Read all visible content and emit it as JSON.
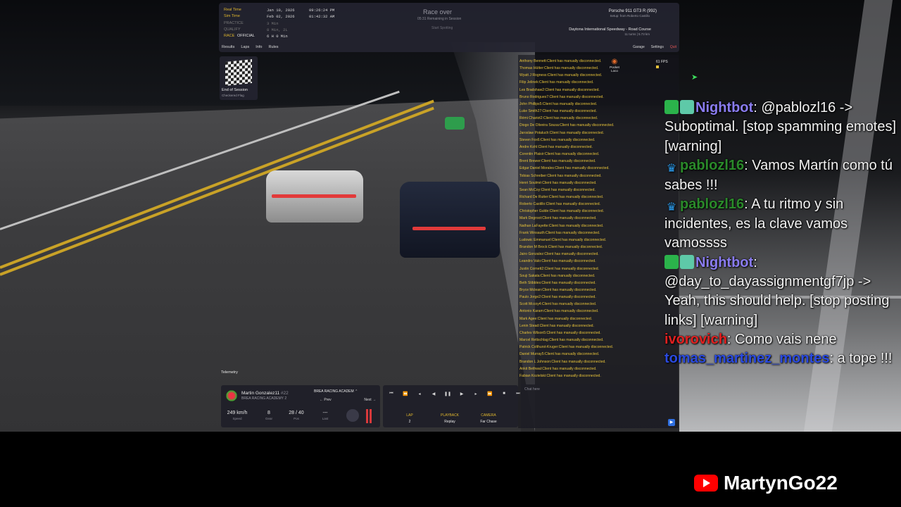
{
  "sim": {
    "time_rows": [
      {
        "label": "Real Time",
        "date": "Jan 10, 2026",
        "time": "09:26:24 PM"
      },
      {
        "label": "Sim Time",
        "date": "Feb 02, 2026",
        "time": "01:42:32 AM"
      }
    ],
    "sessions": [
      {
        "label": "PRACTICE",
        "value": "3 Min"
      },
      {
        "label": "QUALIFY",
        "value": "8 Min, 2L"
      },
      {
        "label": "RACE",
        "tag": "OFFICIAL",
        "value": "6 H 0 Min"
      }
    ],
    "tabs": [
      "Results",
      "Laps",
      "Info",
      "Rules"
    ],
    "race_over": "Race over",
    "remaining": "05:31 Remaining in Session",
    "start_spotting": "Start Spotting",
    "car": "Porsche 911 GT3 R (992)",
    "setup": "Setup: from Roberto Castillo",
    "track": "Daytona International Speedway - Road Course",
    "track_meta": "11 turns | 5.73 km",
    "actions": [
      "Garage",
      "Settings",
      "Quit"
    ],
    "end_session": "End of Session",
    "end_sub": "Checkered Flag",
    "pocket": "Pocket Loco",
    "fps": "61 FPS",
    "chat_placeholder": "Chat here",
    "telemetry": "Telemetry",
    "chat_log": [
      "Anthony Bennett:Client has manually disconnected.",
      "Thomas Hütter:Client has manually disconnected.",
      "Wyatt J Rogness:Client has manually disconnected.",
      "Filip Jelinek:Client has manually disconnected.",
      "Les Bradshaw2:Client has manually disconnected.",
      "Bruno Rodrigues7:Client has manually disconnected.",
      "John Phillips5:Client has manually disconnected.",
      "Luke Smith27:Client has manually disconnected.",
      "Rémi Chariot2:Client has manually disconnected.",
      "Diogo De Oliveira Sousa:Client has manually disconnected.",
      "Jaroslaw Potaluch:Client has manually disconnected.",
      "Steven Fox6:Client has manually disconnected.",
      "Andre Kohl:Client has manually disconnected.",
      "Corentin Plaisir:Client has manually disconnected.",
      "Brent Brewer:Client has manually disconnected.",
      "Edgar Daniel Morales:Client has manually disconnected.",
      "Tobias Schreiber:Client has manually disconnected.",
      "Henri Soulmé:Client has manually disconnected.",
      "Sean McCoy:Client has manually disconnected.",
      "Richard De Ruiter:Client has manually disconnected.",
      "Roberto Castillo:Client has manually disconnected.",
      "Christopher Gulde:Client has manually disconnected.",
      "Mark Degroot:Client has manually disconnected.",
      "Nathan LaFayette:Client has manually disconnected.",
      "Frank Winsauth:Client has manually disconnected.",
      "Ludowic Emmanuel:Client has manually disconnected.",
      "Brandon M Brock:Client has manually disconnected.",
      "Jairo Gonzalez:Client has manually disconnected.",
      "Leandro Valo:Client has manually disconnected.",
      "Justin Cornett2:Client has manually disconnected.",
      "Souji Sakata:Client has manually disconnected.",
      "Beth Stibbles:Client has manually disconnected.",
      "Bryce Mclean:Client has manually disconnected.",
      "Paulo Jorge2:Client has manually disconnected.",
      "Scott Mccoy4:Client has manually disconnected.",
      "Antonio Karam:Client has manually disconnected.",
      "Mark Agee:Client has manually disconnected.",
      "Lenin Stead:Client has manually disconnected.",
      "Charles Wilson5:Client has manually disconnected.",
      "Marcel Rettschlag:Client has manually disconnected.",
      "Patrick Colthurst-Kruger:Client has manually disconnected.",
      "Daniel Murray5:Client has manually disconnected.",
      "Brandon L Johnson:Client has manually disconnected.",
      "Ankit Bethwal:Client has manually disconnected.",
      "Fabian Kozielski:Client has manually disconnected."
    ],
    "driver": {
      "name": "Martin Gonzalez11",
      "number": "#22",
      "team": "BREA RACING ACADEMY 2",
      "team_select": "BREA RACING ACADEM",
      "prev": "Prev",
      "next": "Next",
      "stats": [
        {
          "value": "249 km/h",
          "label": "Speed"
        },
        {
          "value": "8",
          "label": "Gear"
        },
        {
          "value": "28 / 40",
          "label": "Pos"
        },
        {
          "value": "---",
          "label": "Last"
        }
      ]
    },
    "playback": {
      "lap_label": "LAP",
      "lap_value": "2",
      "pb_label": "PLAYBACK",
      "pb_value": "Replay",
      "cam_label": "CAMERA",
      "cam_value": "Far Chase"
    }
  },
  "twitch_chat": [
    {
      "user": "Nightbot",
      "color": "#8a7cf0",
      "badges": [
        "mod",
        "bot"
      ],
      "text": "@pablozl16 -> Suboptimal. [stop spamming emotes] [warning]"
    },
    {
      "user": "pablozl16",
      "color": "#2a8a2a",
      "badges": [
        "crown"
      ],
      "text": "Vamos Martín como tú sabes !!!"
    },
    {
      "user": "pablozl16",
      "color": "#2a8a2a",
      "badges": [
        "crown"
      ],
      "text": "A tu ritmo y sin incidentes, es la clave vamos vamossss"
    },
    {
      "user": "Nightbot",
      "color": "#8a7cf0",
      "badges": [
        "mod",
        "bot"
      ],
      "text": "@day_to_dayassignmentgf7jp -> Yeah, this should help. [stop posting links] [warning]"
    },
    {
      "user": "ivorovich",
      "color": "#e02020",
      "badges": [],
      "text": "Como vais nene"
    },
    {
      "user": "tomas_martinez_montes",
      "color": "#2a4ae0",
      "badges": [],
      "text": "a tope !!!"
    }
  ],
  "channel": "MartynGo22"
}
